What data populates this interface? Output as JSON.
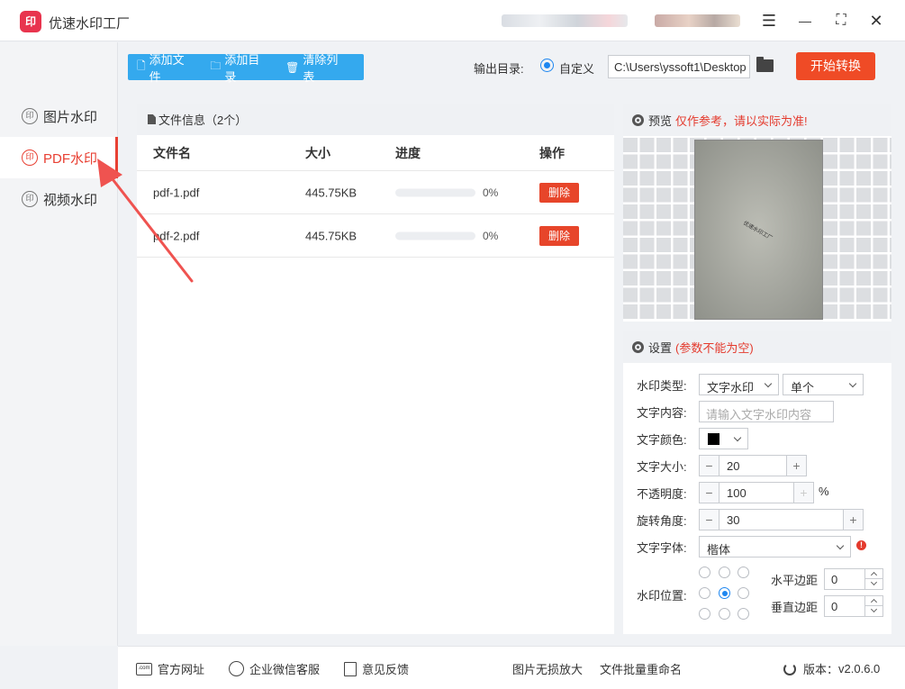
{
  "app": {
    "title": "优速水印工厂",
    "logo_text": "印"
  },
  "window_controls": {
    "menu": "☰",
    "minimize": "—",
    "maximize": "⛶",
    "close": "✕"
  },
  "sidebar": {
    "items": [
      {
        "label": "图片水印",
        "icon": "watermark-icon",
        "active": false
      },
      {
        "label": "PDF水印",
        "icon": "watermark-icon",
        "active": true
      },
      {
        "label": "视频水印",
        "icon": "watermark-icon",
        "active": false
      }
    ],
    "icon_glyph": "印"
  },
  "toolbar": {
    "add_file": "添加文件",
    "add_dir": "添加目录",
    "clear_list": "清除列表",
    "output_label": "输出目录:",
    "radio_label": "自定义",
    "output_path": "C:\\Users\\yssoft1\\Desktop",
    "start": "开始转换"
  },
  "files": {
    "header": "文件信息（2个）",
    "columns": {
      "name": "文件名",
      "size": "大小",
      "progress": "进度",
      "action": "操作"
    },
    "rows": [
      {
        "name": "pdf-1.pdf",
        "size": "445.75KB",
        "progress_pct": "0%",
        "progress": 0,
        "action": "删除"
      },
      {
        "name": "pdf-2.pdf",
        "size": "445.75KB",
        "progress_pct": "0%",
        "progress": 0,
        "action": "删除"
      }
    ]
  },
  "preview": {
    "title": "预览",
    "note": "仅作参考，请以实际为准!",
    "sample_text": "优速水印工厂"
  },
  "settings": {
    "title": "设置",
    "note": "(参数不能为空)",
    "watermark_type_label": "水印类型:",
    "watermark_type_value": "文字水印",
    "mode_value": "单个",
    "text_content_label": "文字内容:",
    "text_content_placeholder": "请输入文字水印内容",
    "text_color_label": "文字颜色:",
    "text_color": "#000000",
    "font_size_label": "文字大小:",
    "font_size": "20",
    "opacity_label": "不透明度:",
    "opacity": "100",
    "opacity_unit": "%",
    "rotation_label": "旋转角度:",
    "rotation": "30",
    "font_label": "文字字体:",
    "font_value": "楷体",
    "position_label": "水印位置:",
    "h_margin_label": "水平边距",
    "h_margin": "0",
    "v_margin_label": "垂直边距",
    "v_margin": "0",
    "stepper_minus": "−",
    "stepper_plus": "+"
  },
  "footer": {
    "website": "官方网址",
    "wechat": "企业微信客服",
    "feedback": "意见反馈",
    "upscale": "图片无损放大",
    "rename": "文件批量重命名",
    "version_label": "版本：",
    "version": "v2.0.6.0",
    "website_icon_text": ".com"
  },
  "colors": {
    "accent": "#34a9ee",
    "danger": "#ef4b26",
    "active": "#e84033"
  }
}
